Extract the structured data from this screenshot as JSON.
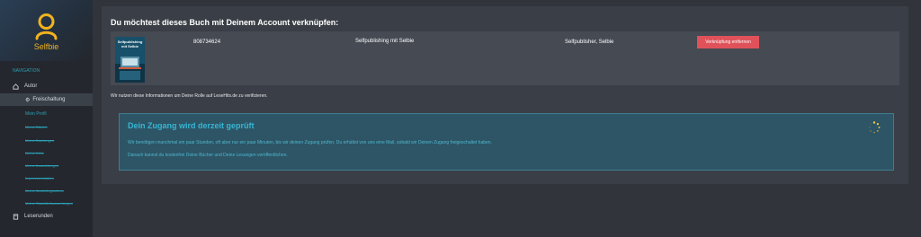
{
  "sidebar": {
    "brand": "Selfbie",
    "section_label": "NAVIGATION",
    "items": [
      {
        "label": "Autor",
        "icon": "home-icon"
      },
      {
        "label": "Freischaltung",
        "icon": "unlock-icon",
        "prefix": "⚙"
      },
      {
        "label": "Mein Profil"
      },
      {
        "label": "Meine Bücher"
      },
      {
        "label": "Meine Buchungen"
      },
      {
        "label": "Meine Infos"
      },
      {
        "label": "Meine Auszahlungen"
      },
      {
        "label": "Impressumsdaten"
      },
      {
        "label": "Meine Marketingbuttons"
      },
      {
        "label": "Meine Statistik-Auswertungen"
      },
      {
        "label": "Leserunden",
        "icon": "book-icon"
      }
    ]
  },
  "main": {
    "title": "Du möchtest dieses Buch mit Deinem Account verknüpfen:",
    "book": {
      "cover_title": "Selfpublishing mit Selbie",
      "isbn": "808734624",
      "title": "Selfpublishing mit Selbie",
      "author": "Selfpublisher, Selbie",
      "remove_label": "Verknüpfung entfernen"
    },
    "info": "Wir nutzen diese Informationen um Deine Rolle auf LeseHits.de zu verifizieren.",
    "notice": {
      "title": "Dein Zugang wird derzeit geprüft",
      "p1": "Wir benötigen manchmal ein paar Stunden, oft aber nur ein paar Minuten, bis wir deinen Zugang prüfen. Du erhältst von uns eine Mail, sobald wir Deinen Zugang freigeschaltet haben.",
      "p2": "Danach kannst du kostenfrei Deine Bücher und Deine Lesungen veröffentlichen."
    }
  },
  "colors": {
    "accent": "#2e9fb5",
    "brand": "#f2b31d",
    "danger": "#e0525a",
    "notice_bg": "#2d5566"
  }
}
